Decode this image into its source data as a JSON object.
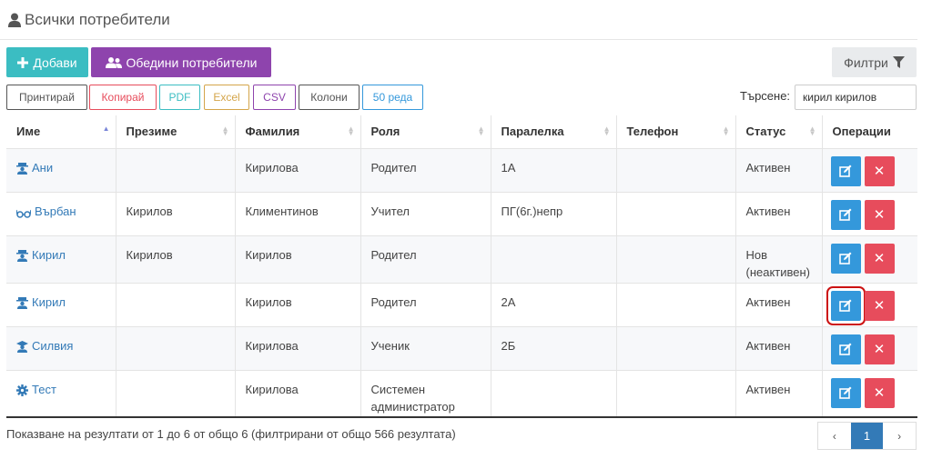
{
  "header": {
    "title": "Всички потребители",
    "icon": "user-icon"
  },
  "toolbar": {
    "add_label": "Добави",
    "merge_label": "Обедини потребители",
    "filter_label": "Филтри"
  },
  "export_buttons": [
    {
      "label": "Принтирай",
      "color": "#555555"
    },
    {
      "label": "Копирай",
      "color": "#e74c5c"
    },
    {
      "label": "PDF",
      "color": "#3bbdc2"
    },
    {
      "label": "Excel",
      "color": "#d4a54a"
    },
    {
      "label": "CSV",
      "color": "#8e44ad"
    },
    {
      "label": "Колони",
      "color": "#555555"
    },
    {
      "label": "50 реда",
      "color": "#3498db"
    }
  ],
  "search": {
    "label": "Търсене:",
    "value": "кирил кирилов"
  },
  "table": {
    "columns": [
      "Име",
      "Презиме",
      "Фамилия",
      "Роля",
      "Паралелка",
      "Телефон",
      "Статус",
      "Операции"
    ],
    "rows": [
      {
        "name": "Ани",
        "icon": "parent-icon",
        "middle": "",
        "last": "Кирилова",
        "role": "Родител",
        "class": "1А",
        "phone": "",
        "status": "Активен"
      },
      {
        "name": "Върбан",
        "icon": "glasses-icon",
        "middle": "Кирилов",
        "last": "Климентинов",
        "role": "Учител",
        "class": "ПГ(6г.)непр",
        "phone": "",
        "status": "Активен"
      },
      {
        "name": "Кирил",
        "icon": "parent-icon",
        "middle": "Кирилов",
        "last": "Кирилов",
        "role": "Родител",
        "class": "",
        "phone": "",
        "status": "Нов (неактивен)"
      },
      {
        "name": "Кирил",
        "icon": "parent-icon",
        "middle": "",
        "last": "Кирилов",
        "role": "Родител",
        "class": "2А",
        "phone": "",
        "status": "Активен"
      },
      {
        "name": "Силвия",
        "icon": "student-icon",
        "middle": "",
        "last": "Кирилова",
        "role": "Ученик",
        "class": "2Б",
        "phone": "",
        "status": "Активен"
      },
      {
        "name": "Тест",
        "icon": "gear-icon",
        "middle": "",
        "last": "Кирилова",
        "role": "Системен администратор",
        "class": "",
        "phone": "",
        "status": "Активен"
      }
    ]
  },
  "footer": {
    "info": "Показване на резултати от 1 до 6 от общо 6 (филтрирани от общо 566 резултата)"
  },
  "pagination": {
    "prev": "‹",
    "page": "1",
    "next": "›"
  }
}
